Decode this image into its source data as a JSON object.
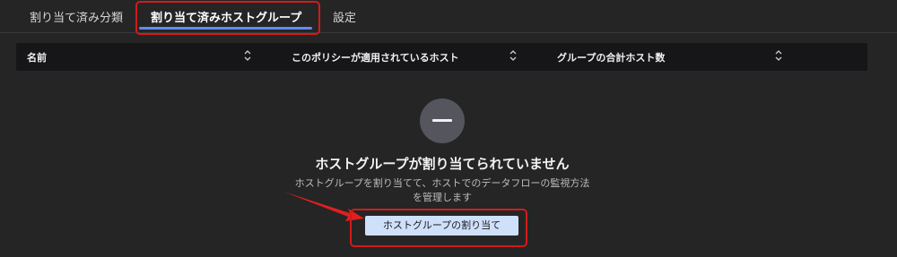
{
  "tabs": {
    "items": [
      {
        "label": "割り当て済み分類"
      },
      {
        "label": "割り当て済みホストグループ"
      },
      {
        "label": "設定"
      }
    ],
    "active_index": 1
  },
  "table": {
    "columns": [
      {
        "label": "名前"
      },
      {
        "label": "このポリシーが適用されているホスト"
      },
      {
        "label": "グループの合計ホスト数"
      }
    ]
  },
  "empty_state": {
    "icon": "minus-icon",
    "title": "ホストグループが割り当てられていません",
    "description": "ホストグループを割り当てて、ホストでのデータフローの監視方法を管理します",
    "button_label": "ホストグループの割り当て"
  },
  "annotation": {
    "highlight_color": "#d11b1b"
  },
  "colors": {
    "background": "#252526",
    "header_bg": "#161618",
    "accent": "#5f8df0",
    "button_bg": "#cfe0fb"
  }
}
